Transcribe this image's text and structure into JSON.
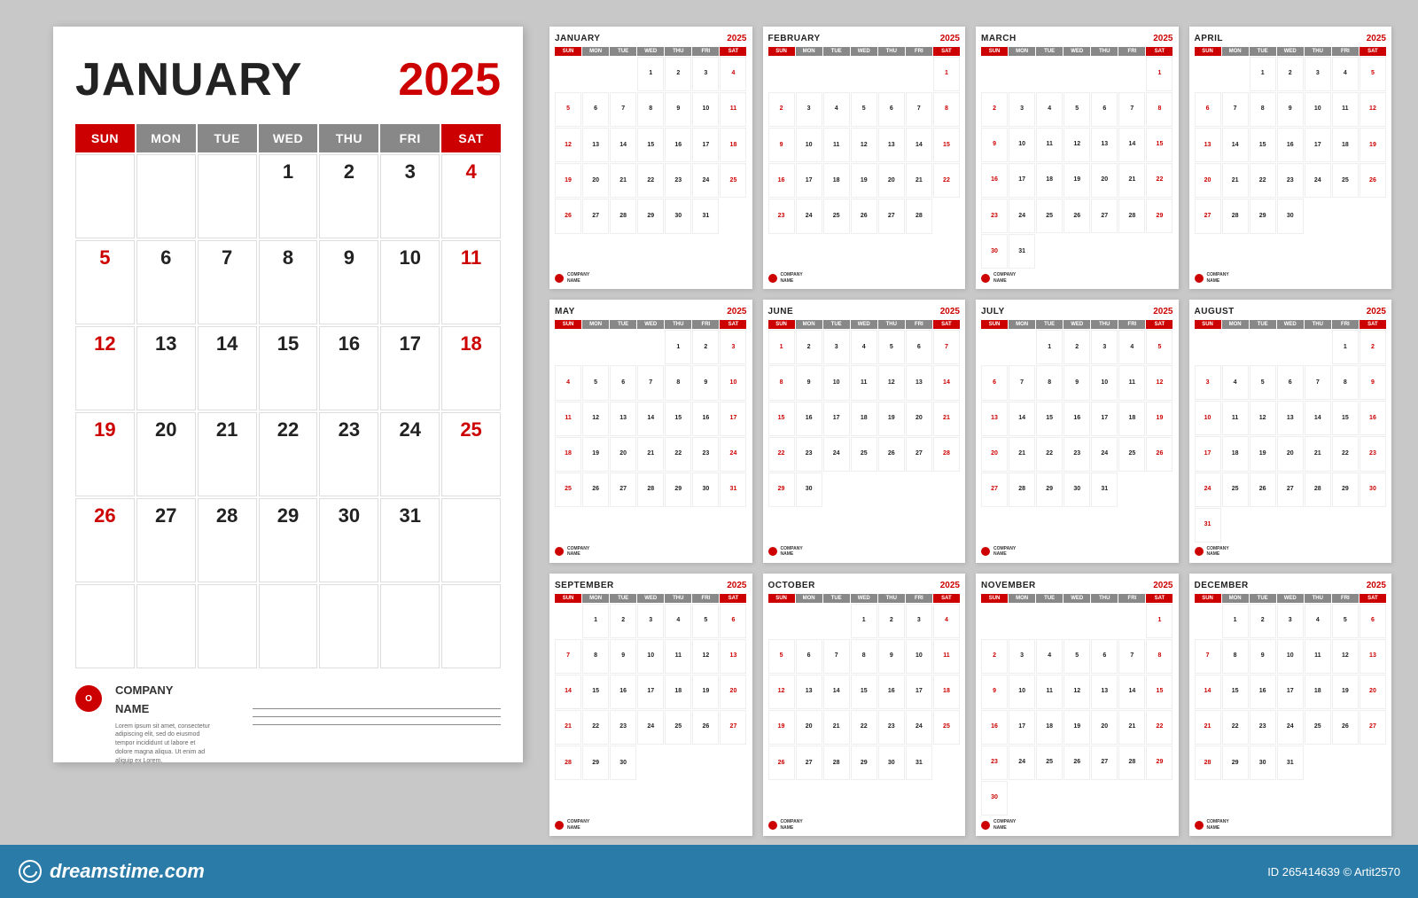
{
  "page": {
    "background": "#c8c8c8",
    "watermark": "dreamstime.com",
    "stock_id": "265414639",
    "author": "Artit2570"
  },
  "dreamstime_bar": {
    "logo": "dreamstime.com",
    "stock_id_label": "ID 265414639 © Artit2570"
  },
  "main_calendar": {
    "month": "JANUARY",
    "year": "2025",
    "days": [
      "SUN",
      "MON",
      "TUE",
      "WED",
      "THU",
      "FRI",
      "SAT"
    ],
    "cells": [
      {
        "num": "",
        "red": false,
        "empty": true
      },
      {
        "num": "",
        "red": false,
        "empty": true
      },
      {
        "num": "",
        "red": false,
        "empty": true
      },
      {
        "num": "1",
        "red": false,
        "empty": false
      },
      {
        "num": "2",
        "red": false,
        "empty": false
      },
      {
        "num": "3",
        "red": false,
        "empty": false
      },
      {
        "num": "4",
        "red": true,
        "empty": false
      },
      {
        "num": "5",
        "red": true,
        "empty": false
      },
      {
        "num": "6",
        "red": false,
        "empty": false
      },
      {
        "num": "7",
        "red": false,
        "empty": false
      },
      {
        "num": "8",
        "red": false,
        "empty": false
      },
      {
        "num": "9",
        "red": false,
        "empty": false
      },
      {
        "num": "10",
        "red": false,
        "empty": false
      },
      {
        "num": "11",
        "red": true,
        "empty": false
      },
      {
        "num": "12",
        "red": true,
        "empty": false
      },
      {
        "num": "13",
        "red": false,
        "empty": false
      },
      {
        "num": "14",
        "red": false,
        "empty": false
      },
      {
        "num": "15",
        "red": false,
        "empty": false
      },
      {
        "num": "16",
        "red": false,
        "empty": false
      },
      {
        "num": "17",
        "red": false,
        "empty": false
      },
      {
        "num": "18",
        "red": true,
        "empty": false
      },
      {
        "num": "19",
        "red": true,
        "empty": false
      },
      {
        "num": "20",
        "red": false,
        "empty": false
      },
      {
        "num": "21",
        "red": false,
        "empty": false
      },
      {
        "num": "22",
        "red": false,
        "empty": false
      },
      {
        "num": "23",
        "red": false,
        "empty": false
      },
      {
        "num": "24",
        "red": false,
        "empty": false
      },
      {
        "num": "25",
        "red": true,
        "empty": false
      },
      {
        "num": "26",
        "red": true,
        "empty": false
      },
      {
        "num": "27",
        "red": false,
        "empty": false
      },
      {
        "num": "28",
        "red": false,
        "empty": false
      },
      {
        "num": "29",
        "red": false,
        "empty": false
      },
      {
        "num": "30",
        "red": false,
        "empty": false
      },
      {
        "num": "31",
        "red": false,
        "empty": false
      },
      {
        "num": "",
        "red": false,
        "empty": true
      },
      {
        "num": "",
        "red": false,
        "empty": true
      },
      {
        "num": "",
        "red": false,
        "empty": true
      },
      {
        "num": "",
        "red": false,
        "empty": true
      },
      {
        "num": "",
        "red": false,
        "empty": true
      },
      {
        "num": "",
        "red": false,
        "empty": true
      },
      {
        "num": "",
        "red": false,
        "empty": true
      },
      {
        "num": "",
        "red": false,
        "empty": true
      }
    ],
    "company_name": "COMPANY\nNAME",
    "company_desc": "Lorem ipsum sit amet, consectetur\nadipiscing elit, sed do eiusmod\ntempor incididunt ut labore et\ndolore magna aliqua. Ut enim ad\naliquip ex Lorem."
  },
  "small_calendars": [
    {
      "month": "JANUARY",
      "year": "2025",
      "cells": [
        "",
        "",
        "",
        "1",
        "2",
        "3",
        "4",
        "5",
        "6",
        "7",
        "8",
        "9",
        "10",
        "11",
        "12",
        "13",
        "14",
        "15",
        "16",
        "17",
        "18",
        "19",
        "20",
        "21",
        "22",
        "23",
        "24",
        "25",
        "26",
        "27",
        "28",
        "29",
        "30",
        "31",
        "",
        "",
        "",
        "",
        "",
        "",
        "",
        ""
      ]
    },
    {
      "month": "FEBRUARY",
      "year": "2025",
      "cells": [
        "",
        "",
        "",
        "",
        "",
        "",
        "1",
        "2",
        "3",
        "4",
        "5",
        "6",
        "7",
        "8",
        "9",
        "10",
        "11",
        "12",
        "13",
        "14",
        "15",
        "16",
        "17",
        "18",
        "19",
        "20",
        "21",
        "22",
        "23",
        "24",
        "25",
        "26",
        "27",
        "28",
        "",
        "",
        "",
        "",
        "",
        "",
        "",
        ""
      ]
    },
    {
      "month": "MARCH",
      "year": "2025",
      "cells": [
        "",
        "",
        "",
        "",
        "",
        "",
        "1",
        "2",
        "3",
        "4",
        "5",
        "6",
        "7",
        "8",
        "9",
        "10",
        "11",
        "12",
        "13",
        "14",
        "15",
        "16",
        "17",
        "18",
        "19",
        "20",
        "21",
        "22",
        "23",
        "24",
        "25",
        "26",
        "27",
        "28",
        "29",
        "30",
        "31",
        "",
        "",
        "",
        "",
        ""
      ]
    },
    {
      "month": "APRIL",
      "year": "2025",
      "cells": [
        "",
        "",
        "1",
        "2",
        "3",
        "4",
        "5",
        "6",
        "7",
        "8",
        "9",
        "10",
        "11",
        "12",
        "13",
        "14",
        "15",
        "16",
        "17",
        "18",
        "19",
        "20",
        "21",
        "22",
        "23",
        "24",
        "25",
        "26",
        "27",
        "28",
        "29",
        "30",
        "",
        "",
        "",
        "",
        "",
        "",
        "",
        "",
        "",
        ""
      ]
    },
    {
      "month": "MAY",
      "year": "2025",
      "cells": [
        "",
        "",
        "",
        "",
        "1",
        "2",
        "3",
        "4",
        "5",
        "6",
        "7",
        "8",
        "9",
        "10",
        "11",
        "12",
        "13",
        "14",
        "15",
        "16",
        "17",
        "18",
        "19",
        "20",
        "21",
        "22",
        "23",
        "24",
        "25",
        "26",
        "27",
        "28",
        "29",
        "30",
        "31",
        "",
        "",
        "",
        "",
        "",
        "",
        ""
      ]
    },
    {
      "month": "JUNE",
      "year": "2025",
      "cells": [
        "1",
        "2",
        "3",
        "4",
        "5",
        "6",
        "7",
        "8",
        "9",
        "10",
        "11",
        "12",
        "13",
        "14",
        "15",
        "16",
        "17",
        "18",
        "19",
        "20",
        "21",
        "22",
        "23",
        "24",
        "25",
        "26",
        "27",
        "28",
        "29",
        "30",
        "",
        "",
        "",
        "",
        "",
        "",
        "",
        "",
        "",
        "",
        "",
        ""
      ]
    },
    {
      "month": "JULY",
      "year": "2025",
      "cells": [
        "",
        "",
        "1",
        "2",
        "3",
        "4",
        "5",
        "6",
        "7",
        "8",
        "9",
        "10",
        "11",
        "12",
        "13",
        "14",
        "15",
        "16",
        "17",
        "18",
        "19",
        "20",
        "21",
        "22",
        "23",
        "24",
        "25",
        "26",
        "27",
        "28",
        "29",
        "30",
        "31",
        "",
        "",
        "",
        "",
        "",
        "",
        "",
        "",
        ""
      ]
    },
    {
      "month": "AUGUST",
      "year": "2025",
      "cells": [
        "",
        "",
        "",
        "",
        "",
        "1",
        "2",
        "3",
        "4",
        "5",
        "6",
        "7",
        "8",
        "9",
        "10",
        "11",
        "12",
        "13",
        "14",
        "15",
        "16",
        "17",
        "18",
        "19",
        "20",
        "21",
        "22",
        "23",
        "24",
        "25",
        "26",
        "27",
        "28",
        "29",
        "30",
        "31",
        "",
        "",
        "",
        "",
        "",
        "",
        ""
      ]
    },
    {
      "month": "SEPTEMBER",
      "year": "2025",
      "cells": [
        "",
        "1",
        "2",
        "3",
        "4",
        "5",
        "6",
        "7",
        "8",
        "9",
        "10",
        "11",
        "12",
        "13",
        "14",
        "15",
        "16",
        "17",
        "18",
        "19",
        "20",
        "21",
        "22",
        "23",
        "24",
        "25",
        "26",
        "27",
        "28",
        "29",
        "30",
        "",
        "",
        "",
        "",
        "",
        "",
        "",
        "",
        "",
        "",
        ""
      ]
    },
    {
      "month": "OCTOBER",
      "year": "2025",
      "cells": [
        "",
        "",
        "",
        "1",
        "2",
        "3",
        "4",
        "5",
        "6",
        "7",
        "8",
        "9",
        "10",
        "11",
        "12",
        "13",
        "14",
        "15",
        "16",
        "17",
        "18",
        "19",
        "20",
        "21",
        "22",
        "23",
        "24",
        "25",
        "26",
        "27",
        "28",
        "29",
        "30",
        "31",
        "",
        "",
        "",
        "",
        "",
        "",
        "",
        ""
      ]
    },
    {
      "month": "NOVEMBER",
      "year": "2025",
      "cells": [
        "",
        "",
        "",
        "",
        "",
        "",
        "1",
        "2",
        "3",
        "4",
        "5",
        "6",
        "7",
        "8",
        "9",
        "10",
        "11",
        "12",
        "13",
        "14",
        "15",
        "16",
        "17",
        "18",
        "19",
        "20",
        "21",
        "22",
        "23",
        "24",
        "25",
        "26",
        "27",
        "28",
        "29",
        "30",
        "",
        "",
        "",
        "",
        "",
        "",
        "",
        ""
      ]
    },
    {
      "month": "DECEMBER",
      "year": "2025",
      "cells": [
        "",
        "1",
        "2",
        "3",
        "4",
        "5",
        "6",
        "7",
        "8",
        "9",
        "10",
        "11",
        "12",
        "13",
        "14",
        "15",
        "16",
        "17",
        "18",
        "19",
        "20",
        "21",
        "22",
        "23",
        "24",
        "25",
        "26",
        "27",
        "28",
        "29",
        "30",
        "31",
        "",
        "",
        "",
        "",
        "",
        "",
        "",
        "",
        "",
        ""
      ]
    }
  ],
  "days_abbr": [
    "SUN",
    "MON",
    "TUE",
    "WED",
    "THU",
    "FRI",
    "SAT"
  ]
}
